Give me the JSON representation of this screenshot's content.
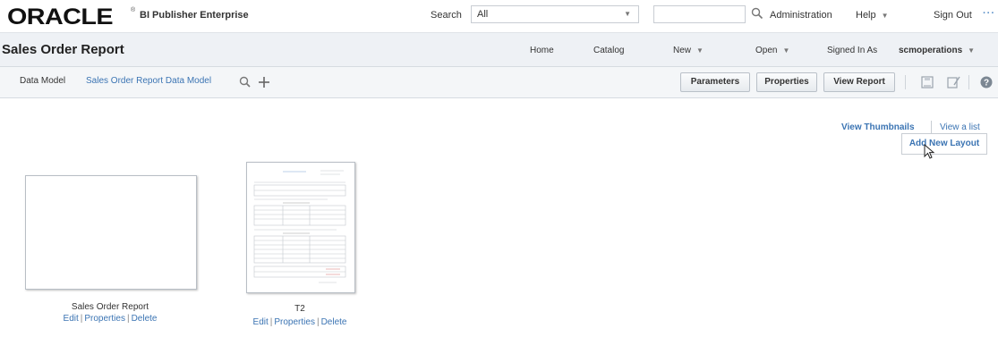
{
  "brand": {
    "logo_text": "ORACLE",
    "registered": "®",
    "product": "BI Publisher Enterprise"
  },
  "search": {
    "label": "Search",
    "scope_value": "All",
    "query_value": ""
  },
  "top_nav": {
    "administration": "Administration",
    "help": "Help",
    "sign_out": "Sign Out",
    "more": "···"
  },
  "title_bar": {
    "title": "Sales Order Report",
    "home": "Home",
    "catalog": "Catalog",
    "new": "New",
    "open": "Open",
    "signed_in_label": "Signed In As",
    "user": "scmoperations"
  },
  "toolbar": {
    "data_model_label": "Data Model",
    "data_model_value": "Sales Order Report Data Model",
    "parameters": "Parameters",
    "properties": "Properties",
    "view_report": "View Report"
  },
  "view_options": {
    "thumbnails": "View Thumbnails",
    "list": "View a list"
  },
  "add_layout": "Add New Layout",
  "layouts": [
    {
      "name": "Sales Order Report",
      "edit": "Edit",
      "properties": "Properties",
      "delete": "Delete"
    },
    {
      "name": "T2",
      "edit": "Edit",
      "properties": "Properties",
      "delete": "Delete"
    }
  ],
  "colors": {
    "link": "#3b74b3",
    "titlebar_bg": "#eef1f5",
    "toolbar_bg": "#f4f6f8"
  }
}
